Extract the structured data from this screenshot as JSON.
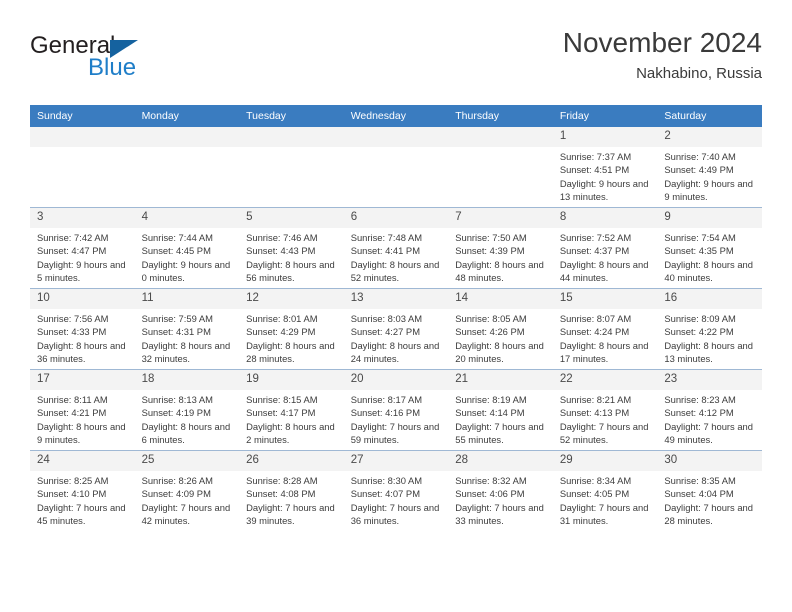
{
  "brand": {
    "name_part1": "General",
    "name_part2": "Blue",
    "logo_icon": "triangle-logo-icon"
  },
  "header": {
    "title": "November 2024",
    "subtitle": "Nakhabino, Russia"
  },
  "colors": {
    "header_band": "#3a7cc0",
    "daynum_band": "#f3f3f3",
    "brand_blue": "#1f7ec8",
    "brand_dark": "#231f20",
    "grid_line": "#9fb8d4"
  },
  "weekday_headers": [
    "Sunday",
    "Monday",
    "Tuesday",
    "Wednesday",
    "Thursday",
    "Friday",
    "Saturday"
  ],
  "weeks": [
    [
      {
        "day": "",
        "empty": true
      },
      {
        "day": "",
        "empty": true
      },
      {
        "day": "",
        "empty": true
      },
      {
        "day": "",
        "empty": true
      },
      {
        "day": "",
        "empty": true
      },
      {
        "day": "1",
        "sunrise": "Sunrise: 7:37 AM",
        "sunset": "Sunset: 4:51 PM",
        "daylight": "Daylight: 9 hours and 13 minutes."
      },
      {
        "day": "2",
        "sunrise": "Sunrise: 7:40 AM",
        "sunset": "Sunset: 4:49 PM",
        "daylight": "Daylight: 9 hours and 9 minutes."
      }
    ],
    [
      {
        "day": "3",
        "sunrise": "Sunrise: 7:42 AM",
        "sunset": "Sunset: 4:47 PM",
        "daylight": "Daylight: 9 hours and 5 minutes."
      },
      {
        "day": "4",
        "sunrise": "Sunrise: 7:44 AM",
        "sunset": "Sunset: 4:45 PM",
        "daylight": "Daylight: 9 hours and 0 minutes."
      },
      {
        "day": "5",
        "sunrise": "Sunrise: 7:46 AM",
        "sunset": "Sunset: 4:43 PM",
        "daylight": "Daylight: 8 hours and 56 minutes."
      },
      {
        "day": "6",
        "sunrise": "Sunrise: 7:48 AM",
        "sunset": "Sunset: 4:41 PM",
        "daylight": "Daylight: 8 hours and 52 minutes."
      },
      {
        "day": "7",
        "sunrise": "Sunrise: 7:50 AM",
        "sunset": "Sunset: 4:39 PM",
        "daylight": "Daylight: 8 hours and 48 minutes."
      },
      {
        "day": "8",
        "sunrise": "Sunrise: 7:52 AM",
        "sunset": "Sunset: 4:37 PM",
        "daylight": "Daylight: 8 hours and 44 minutes."
      },
      {
        "day": "9",
        "sunrise": "Sunrise: 7:54 AM",
        "sunset": "Sunset: 4:35 PM",
        "daylight": "Daylight: 8 hours and 40 minutes."
      }
    ],
    [
      {
        "day": "10",
        "sunrise": "Sunrise: 7:56 AM",
        "sunset": "Sunset: 4:33 PM",
        "daylight": "Daylight: 8 hours and 36 minutes."
      },
      {
        "day": "11",
        "sunrise": "Sunrise: 7:59 AM",
        "sunset": "Sunset: 4:31 PM",
        "daylight": "Daylight: 8 hours and 32 minutes."
      },
      {
        "day": "12",
        "sunrise": "Sunrise: 8:01 AM",
        "sunset": "Sunset: 4:29 PM",
        "daylight": "Daylight: 8 hours and 28 minutes."
      },
      {
        "day": "13",
        "sunrise": "Sunrise: 8:03 AM",
        "sunset": "Sunset: 4:27 PM",
        "daylight": "Daylight: 8 hours and 24 minutes."
      },
      {
        "day": "14",
        "sunrise": "Sunrise: 8:05 AM",
        "sunset": "Sunset: 4:26 PM",
        "daylight": "Daylight: 8 hours and 20 minutes."
      },
      {
        "day": "15",
        "sunrise": "Sunrise: 8:07 AM",
        "sunset": "Sunset: 4:24 PM",
        "daylight": "Daylight: 8 hours and 17 minutes."
      },
      {
        "day": "16",
        "sunrise": "Sunrise: 8:09 AM",
        "sunset": "Sunset: 4:22 PM",
        "daylight": "Daylight: 8 hours and 13 minutes."
      }
    ],
    [
      {
        "day": "17",
        "sunrise": "Sunrise: 8:11 AM",
        "sunset": "Sunset: 4:21 PM",
        "daylight": "Daylight: 8 hours and 9 minutes."
      },
      {
        "day": "18",
        "sunrise": "Sunrise: 8:13 AM",
        "sunset": "Sunset: 4:19 PM",
        "daylight": "Daylight: 8 hours and 6 minutes."
      },
      {
        "day": "19",
        "sunrise": "Sunrise: 8:15 AM",
        "sunset": "Sunset: 4:17 PM",
        "daylight": "Daylight: 8 hours and 2 minutes."
      },
      {
        "day": "20",
        "sunrise": "Sunrise: 8:17 AM",
        "sunset": "Sunset: 4:16 PM",
        "daylight": "Daylight: 7 hours and 59 minutes."
      },
      {
        "day": "21",
        "sunrise": "Sunrise: 8:19 AM",
        "sunset": "Sunset: 4:14 PM",
        "daylight": "Daylight: 7 hours and 55 minutes."
      },
      {
        "day": "22",
        "sunrise": "Sunrise: 8:21 AM",
        "sunset": "Sunset: 4:13 PM",
        "daylight": "Daylight: 7 hours and 52 minutes."
      },
      {
        "day": "23",
        "sunrise": "Sunrise: 8:23 AM",
        "sunset": "Sunset: 4:12 PM",
        "daylight": "Daylight: 7 hours and 49 minutes."
      }
    ],
    [
      {
        "day": "24",
        "sunrise": "Sunrise: 8:25 AM",
        "sunset": "Sunset: 4:10 PM",
        "daylight": "Daylight: 7 hours and 45 minutes."
      },
      {
        "day": "25",
        "sunrise": "Sunrise: 8:26 AM",
        "sunset": "Sunset: 4:09 PM",
        "daylight": "Daylight: 7 hours and 42 minutes."
      },
      {
        "day": "26",
        "sunrise": "Sunrise: 8:28 AM",
        "sunset": "Sunset: 4:08 PM",
        "daylight": "Daylight: 7 hours and 39 minutes."
      },
      {
        "day": "27",
        "sunrise": "Sunrise: 8:30 AM",
        "sunset": "Sunset: 4:07 PM",
        "daylight": "Daylight: 7 hours and 36 minutes."
      },
      {
        "day": "28",
        "sunrise": "Sunrise: 8:32 AM",
        "sunset": "Sunset: 4:06 PM",
        "daylight": "Daylight: 7 hours and 33 minutes."
      },
      {
        "day": "29",
        "sunrise": "Sunrise: 8:34 AM",
        "sunset": "Sunset: 4:05 PM",
        "daylight": "Daylight: 7 hours and 31 minutes."
      },
      {
        "day": "30",
        "sunrise": "Sunrise: 8:35 AM",
        "sunset": "Sunset: 4:04 PM",
        "daylight": "Daylight: 7 hours and 28 minutes."
      }
    ]
  ]
}
